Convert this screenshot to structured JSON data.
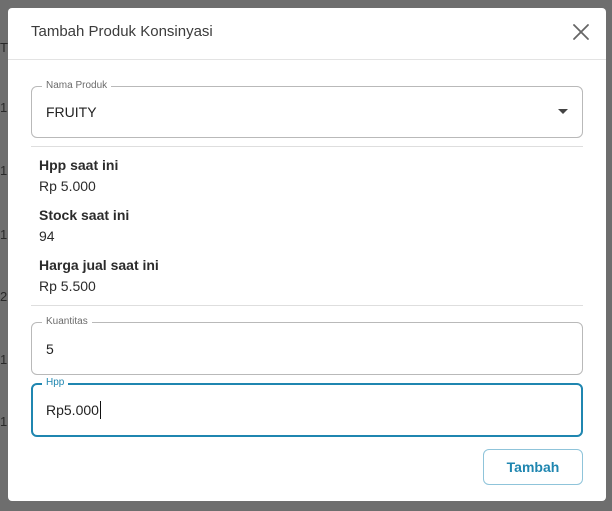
{
  "backdrop": {
    "glyphs": [
      "T",
      "1",
      "1",
      "1",
      "2",
      "1",
      "1"
    ]
  },
  "modal": {
    "title": "Tambah Produk Konsinyasi",
    "close_icon": "close-icon"
  },
  "product_select": {
    "label": "Nama Produk",
    "value": "FRUITY",
    "arrow_icon": "caret-down-icon"
  },
  "info": {
    "hpp_label": "Hpp saat ini",
    "hpp_value": "Rp 5.000",
    "stock_label": "Stock saat ini",
    "stock_value": "94",
    "price_label": "Harga jual saat ini",
    "price_value": "Rp 5.500"
  },
  "quantity_field": {
    "label": "Kuantitas",
    "value": "5"
  },
  "hpp_field": {
    "label": "Hpp",
    "value": "Rp5.000"
  },
  "actions": {
    "submit_label": "Tambah"
  },
  "colors": {
    "accent": "#1f86b0",
    "backdrop": "#6e6e6e"
  }
}
